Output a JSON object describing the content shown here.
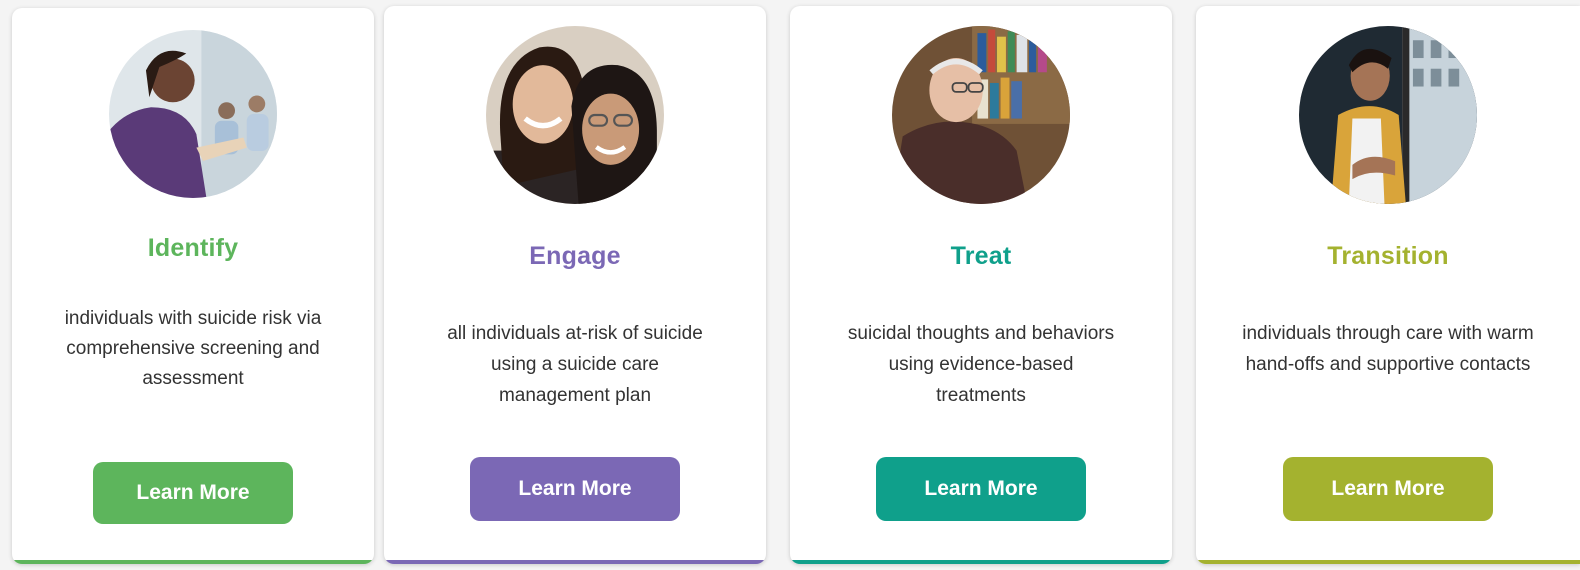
{
  "cards": [
    {
      "title": "Identify",
      "description": "individuals with suicide risk via comprehensive screening and assessment",
      "button_label": "Learn More",
      "color": "#5db55c"
    },
    {
      "title": "Engage",
      "description": "all individuals at-risk of suicide using a suicide care management plan",
      "button_label": "Learn More",
      "color": "#7b68b5"
    },
    {
      "title": "Treat",
      "description": "suicidal thoughts and behaviors using evidence-based treatments",
      "button_label": "Learn More",
      "color": "#0fa08b"
    },
    {
      "title": "Transition",
      "description": "individuals through care with warm hand-offs and supportive contacts",
      "button_label": "Learn More",
      "color": "#a4b22f"
    }
  ]
}
